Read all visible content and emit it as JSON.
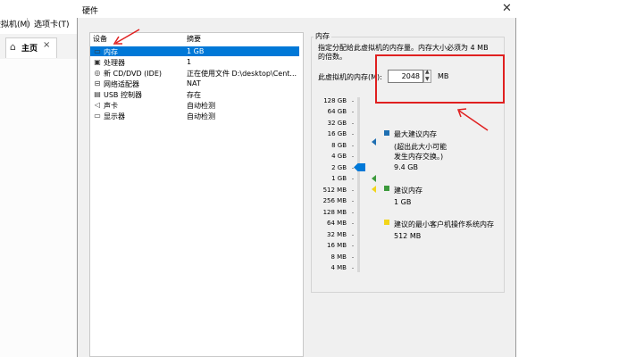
{
  "background": {
    "menu": [
      "虚拟机(M)",
      "选项卡(T)"
    ],
    "tab_label": "主页",
    "tab_close": "×"
  },
  "dialog": {
    "title": "硬件",
    "close": "✕",
    "columns": {
      "device": "设备",
      "summary": "摘要"
    },
    "devices": [
      {
        "icon": "memory-icon",
        "name": "内存",
        "summary": "1 GB",
        "selected": true
      },
      {
        "icon": "processor-icon",
        "name": "处理器",
        "summary": "1"
      },
      {
        "icon": "cd-dvd-icon",
        "name": "新 CD/DVD (IDE)",
        "summary": "正在使用文件 D:\\desktop\\Cent..."
      },
      {
        "icon": "network-adapter-icon",
        "name": "网络适配器",
        "summary": "NAT"
      },
      {
        "icon": "usb-controller-icon",
        "name": "USB 控制器",
        "summary": "存在"
      },
      {
        "icon": "sound-card-icon",
        "name": "声卡",
        "summary": "自动检测"
      },
      {
        "icon": "display-icon",
        "name": "显示器",
        "summary": "自动检测"
      }
    ],
    "memory": {
      "group_label": "内存",
      "description_line1": "指定分配给此虚拟机的内存量。内存大小必须为 4 MB",
      "description_line2": "的倍数。",
      "field_label": "此虚拟机的内存(M):",
      "value": "2048",
      "unit": "MB",
      "scale": [
        "128 GB",
        "64 GB",
        "32 GB",
        "16 GB",
        "8 GB",
        "4 GB",
        "2 GB",
        "1 GB",
        "512 MB",
        "256 MB",
        "128 MB",
        "64 MB",
        "32 MB",
        "16 MB",
        "8 MB",
        "4 MB"
      ],
      "legend": {
        "max_title": "最大建议内存",
        "max_note1": "(超出此大小可能",
        "max_note2": "发生内存交换。)",
        "max_value": "9.4 GB",
        "rec_title": "建议内存",
        "rec_value": "1 GB",
        "min_title": "建议的最小客户机操作系统内存",
        "min_value": "512 MB"
      },
      "colors": {
        "max": "#1f6fb2",
        "recommended": "#3c9a3c",
        "minimum": "#f2d51a",
        "slider": "#0078d7",
        "highlight": "#e02020"
      }
    }
  }
}
